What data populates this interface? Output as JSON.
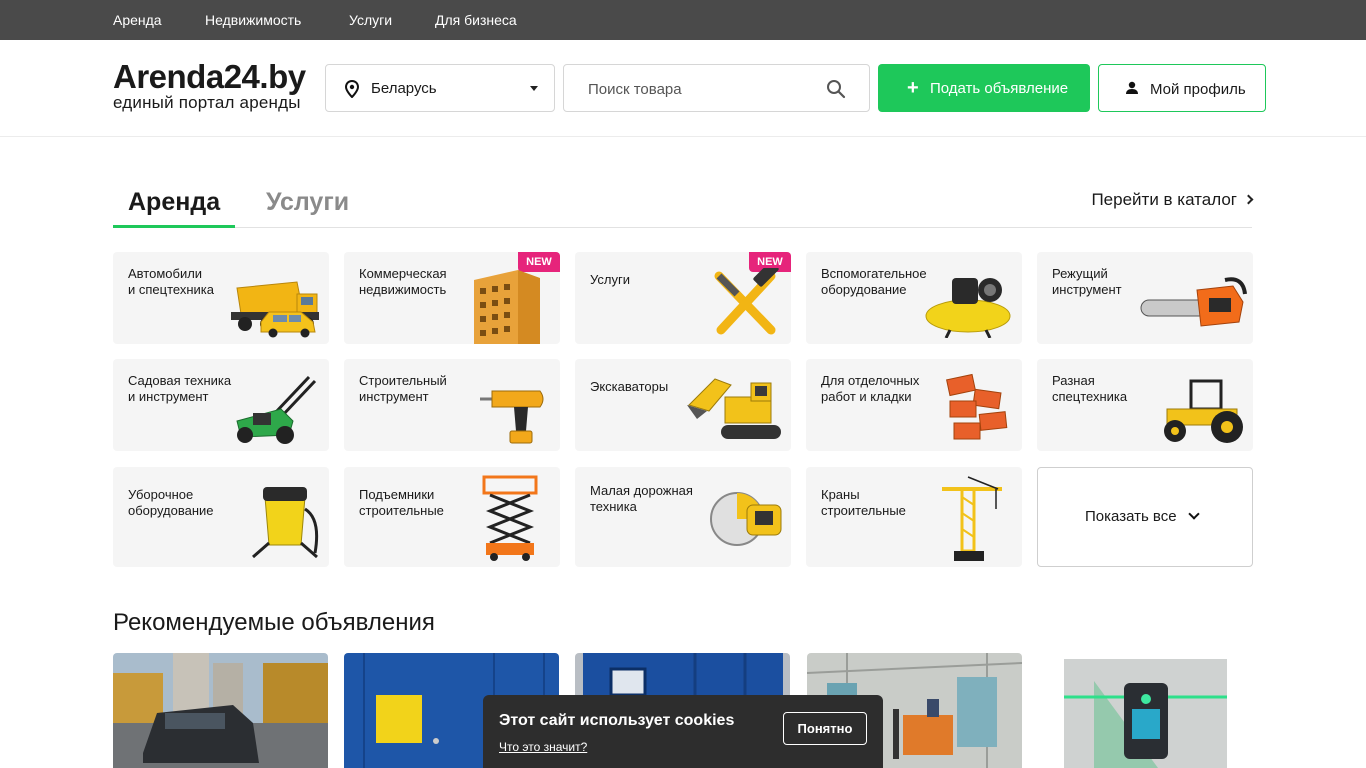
{
  "topnav": {
    "items": [
      "Аренда",
      "Недвижимость",
      "Услуги",
      "Для бизнеса"
    ]
  },
  "header": {
    "logo_title": "Arenda24.by",
    "logo_subtitle": "единый портал аренды",
    "region": "Беларусь",
    "search_placeholder": "Поиск товара",
    "post_button": "Подать объявление",
    "profile_button": "Мой профиль"
  },
  "tabs": {
    "items": [
      "Аренда",
      "Услуги"
    ],
    "active": "Аренда",
    "catalog_link": "Перейти в каталог"
  },
  "categories": [
    {
      "label": "Автомобили\nи спецтехника",
      "icon": "dump-truck-icon",
      "badge": ""
    },
    {
      "label": "Коммерческая\nнедвижимость",
      "icon": "building-icon",
      "badge": "NEW"
    },
    {
      "label": "Услуги",
      "icon": "hammer-wrench-icon",
      "badge": "NEW"
    },
    {
      "label": "Вспомогательное\nоборудование",
      "icon": "compressor-icon",
      "badge": ""
    },
    {
      "label": "Режущий\nинструмент",
      "icon": "chainsaw-icon",
      "badge": ""
    },
    {
      "label": "Садовая техника\nи инструмент",
      "icon": "lawn-mower-icon",
      "badge": ""
    },
    {
      "label": "Строительный\nинструмент",
      "icon": "drill-icon",
      "badge": ""
    },
    {
      "label": "Экскаваторы",
      "icon": "excavator-icon",
      "badge": ""
    },
    {
      "label": "Для отделочных\nработ и кладки",
      "icon": "bricks-icon",
      "badge": ""
    },
    {
      "label": "Разная\nспецтехника",
      "icon": "tractor-icon",
      "badge": ""
    },
    {
      "label": "Уборочное\nоборудование",
      "icon": "vacuum-cleaner-icon",
      "badge": ""
    },
    {
      "label": "Подъемники\nстроительные",
      "icon": "scissor-lift-icon",
      "badge": ""
    },
    {
      "label": "Малая дорожная\nтехника",
      "icon": "concrete-saw-icon",
      "badge": ""
    },
    {
      "label": "Краны\nстроительные",
      "icon": "tower-crane-icon",
      "badge": ""
    }
  ],
  "show_all": "Показать все",
  "recommended": {
    "title": "Рекомендуемые объявления",
    "listings": [
      {
        "image": "car-photo"
      },
      {
        "image": "container-photo"
      },
      {
        "image": "container-photo"
      },
      {
        "image": "forklift-photo"
      },
      {
        "image": "laser-level-photo"
      }
    ]
  },
  "cookie": {
    "title": "Этот сайт использует cookies",
    "link": "Что это значит?",
    "button": "Понятно"
  },
  "colors": {
    "accent": "#1ec85a",
    "topbar": "#4a4a4a",
    "badge": "#e6247b",
    "cookie_bg": "#2d2d2d"
  }
}
